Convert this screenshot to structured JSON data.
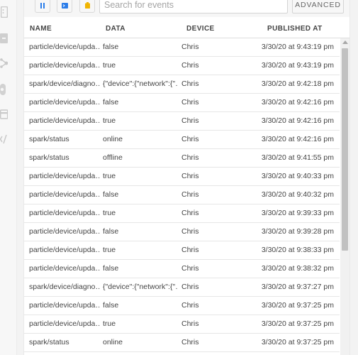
{
  "nav": {
    "icons": [
      "devices-icon",
      "console-icon",
      "mesh-network-icon",
      "integrations-icon",
      "billing-icon",
      "code-icon"
    ]
  },
  "toolbar": {
    "pause_icon": "pause-icon",
    "terminal_icon": "terminal-icon",
    "clear_icon": "clear-icon",
    "search_placeholder": "Search for events",
    "search_value": "",
    "advanced_label": "ADVANCED"
  },
  "table": {
    "headers": {
      "name": "NAME",
      "data": "DATA",
      "device": "DEVICE",
      "published": "PUBLISHED AT"
    },
    "rows": [
      {
        "name": "particle/device/upda…",
        "data": "false",
        "device": "Chris",
        "published": "3/30/20 at 9:43:19 pm"
      },
      {
        "name": "particle/device/upda…",
        "data": "true",
        "device": "Chris",
        "published": "3/30/20 at 9:43:19 pm"
      },
      {
        "name": "spark/device/diagno…",
        "data": "{\"device\":{\"network\":{\"…",
        "device": "Chris",
        "published": "3/30/20 at 9:42:18 pm"
      },
      {
        "name": "particle/device/upda…",
        "data": "false",
        "device": "Chris",
        "published": "3/30/20 at 9:42:16 pm"
      },
      {
        "name": "particle/device/upda…",
        "data": "true",
        "device": "Chris",
        "published": "3/30/20 at 9:42:16 pm"
      },
      {
        "name": "spark/status",
        "data": "online",
        "device": "Chris",
        "published": "3/30/20 at 9:42:16 pm"
      },
      {
        "name": "spark/status",
        "data": "offline",
        "device": "Chris",
        "published": "3/30/20 at 9:41:55 pm"
      },
      {
        "name": "particle/device/upda…",
        "data": "true",
        "device": "Chris",
        "published": "3/30/20 at 9:40:33 pm"
      },
      {
        "name": "particle/device/upda…",
        "data": "false",
        "device": "Chris",
        "published": "3/30/20 at 9:40:32 pm"
      },
      {
        "name": "particle/device/upda…",
        "data": "true",
        "device": "Chris",
        "published": "3/30/20 at 9:39:33 pm"
      },
      {
        "name": "particle/device/upda…",
        "data": "false",
        "device": "Chris",
        "published": "3/30/20 at 9:39:28 pm"
      },
      {
        "name": "particle/device/upda…",
        "data": "true",
        "device": "Chris",
        "published": "3/30/20 at 9:38:33 pm"
      },
      {
        "name": "particle/device/upda…",
        "data": "false",
        "device": "Chris",
        "published": "3/30/20 at 9:38:32 pm"
      },
      {
        "name": "spark/device/diagno…",
        "data": "{\"device\":{\"network\":{\"…",
        "device": "Chris",
        "published": "3/30/20 at 9:37:27 pm"
      },
      {
        "name": "particle/device/upda…",
        "data": "false",
        "device": "Chris",
        "published": "3/30/20 at 9:37:25 pm"
      },
      {
        "name": "particle/device/upda…",
        "data": "true",
        "device": "Chris",
        "published": "3/30/20 at 9:37:25 pm"
      },
      {
        "name": "spark/status",
        "data": "online",
        "device": "Chris",
        "published": "3/30/20 at 9:37:25 pm"
      },
      {
        "name": "",
        "data": "",
        "device": "",
        "published": ""
      }
    ]
  },
  "colors": {
    "pause_accent": "#2b7de9",
    "terminal_accent": "#2b7de9",
    "clear_accent": "#f0b400"
  }
}
